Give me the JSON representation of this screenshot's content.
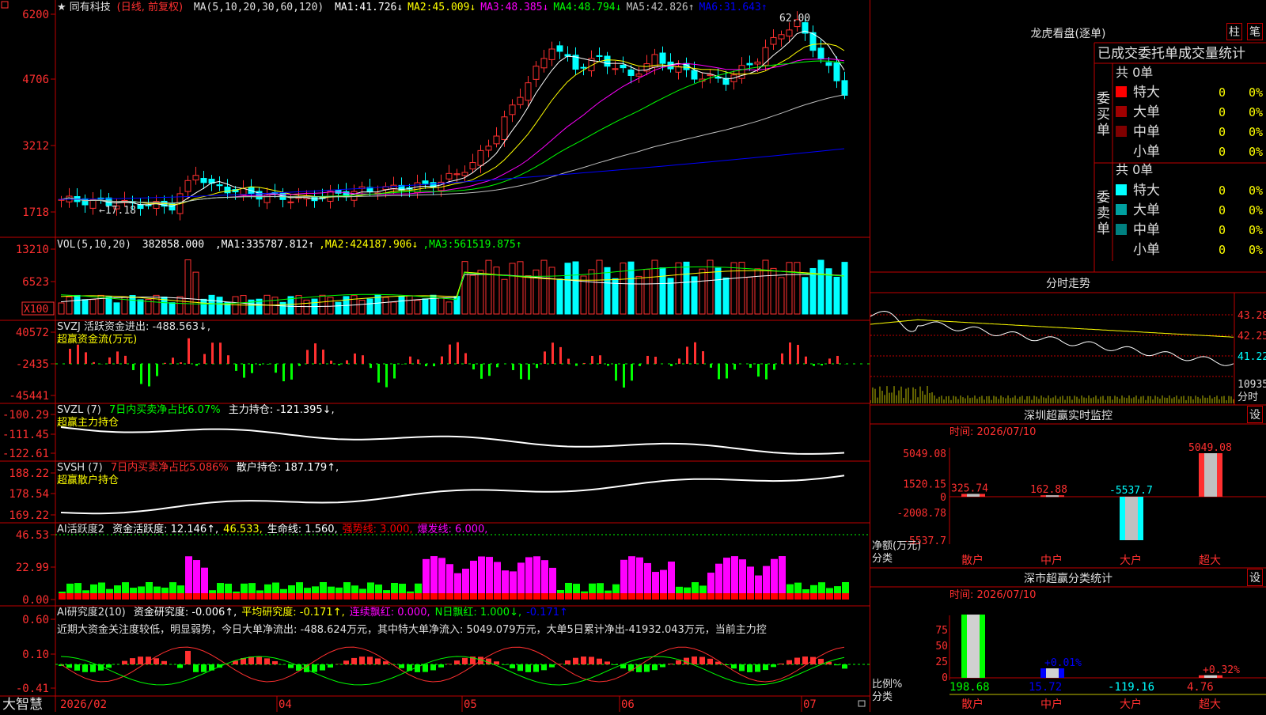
{
  "logo_text": "大智慧",
  "main_chart": {
    "title": "★ 同有科技",
    "period_label": "(日线, 前复权)",
    "ma_header": "MA(5,10,20,30,60,120)",
    "ma_values": [
      {
        "label": "MA1:",
        "value": "41.726",
        "arrow": "↓",
        "color": "#ffffff"
      },
      {
        "label": "MA2:",
        "value": "45.009",
        "arrow": "↓",
        "color": "#ffff00"
      },
      {
        "label": "MA3:",
        "value": "48.385",
        "arrow": "↓",
        "color": "#ff00ff"
      },
      {
        "label": "MA4:",
        "value": "48.794",
        "arrow": "↓",
        "color": "#00ff00"
      },
      {
        "label": "MA5:",
        "value": "42.826",
        "arrow": "↑",
        "color": "#c0c0c0"
      },
      {
        "label": "MA6:",
        "value": "31.643",
        "arrow": "↑",
        "color": "#0000ff"
      }
    ],
    "y_ticks": [
      "6200",
      "4706",
      "3212",
      "1718"
    ],
    "low_marker": "←17.18",
    "high_marker": "62.00"
  },
  "vol_panel": {
    "header": "VOL(5,10,20)",
    "value": "382858.000",
    "mas": [
      {
        "label": "MA1:",
        "value": "335787.812",
        "arrow": "↑",
        "color": "#ffffff"
      },
      {
        "label": "MA2:",
        "value": "424187.906",
        "arrow": "↓",
        "color": "#ffff00"
      },
      {
        "label": "MA3:",
        "value": "561519.875",
        "arrow": "↑",
        "color": "#00ff00"
      }
    ],
    "y_ticks": [
      "13210",
      "6523"
    ],
    "unit": "X100"
  },
  "svzj_panel": {
    "line1": "SVZJ  活跃资金进出: -488.563↓,",
    "line2": "超赢资金流(万元)",
    "y_ticks": [
      "40572",
      "-2435",
      "-45441"
    ]
  },
  "svzl_panel": {
    "name": "SVZL (7)",
    "part1": "7日内买卖净占比6.07%",
    "part2": "主力持仓: -121.395↓,",
    "line2": "超赢主力持仓",
    "y_ticks": [
      "-100.29",
      "-111.45",
      "-122.61"
    ]
  },
  "svsh_panel": {
    "name": "SVSH (7)",
    "part1": "7日内买卖净占比5.086%",
    "part2": "散户持仓: 187.179↑,",
    "line2": "超赢散户持仓",
    "y_ticks": [
      "188.22",
      "178.54",
      "169.22"
    ]
  },
  "ai2_panel": {
    "name": "AI活跃度2",
    "items": [
      {
        "text": "资金活跃度: 12.146↑,",
        "color": "#ffffff"
      },
      {
        "text": "46.533,",
        "color": "#ffff00"
      },
      {
        "text": "生命线: 1.560,",
        "color": "#ffffff"
      },
      {
        "text": "强势线: 3.000,",
        "color": "#ff0000"
      },
      {
        "text": "爆发线: 6.000,",
        "color": "#ff00ff"
      }
    ],
    "y_ticks": [
      "46.53",
      "22.99",
      "0.00"
    ]
  },
  "ai_research_panel": {
    "name": "AI研究度2(10)",
    "items": [
      {
        "text": "资金研究度: -0.006↑,",
        "color": "#ffffff"
      },
      {
        "text": "平均研究度: -0.171↑,",
        "color": "#ffff00"
      },
      {
        "text": "连续飘红: 0.000,",
        "color": "#ff00ff"
      },
      {
        "text": "N日飘红: 1.000↓,",
        "color": "#00ff00"
      },
      {
        "text": "-0.171↑",
        "color": "#0000ff"
      }
    ],
    "comment": "近期大资金关注度较低，明显弱势，今日大单净流出: -488.624万元，其中特大单净流入: 5049.079万元，大单5日累计净出-41932.043万元，当前主力控",
    "y_ticks": [
      "0.60",
      "0.10",
      "-0.41"
    ]
  },
  "x_axis": [
    "2026/02",
    "04",
    "05",
    "06",
    "07"
  ],
  "lhb": {
    "title": "龙虎看盘(逐单)",
    "btn1": "柱",
    "btn2": "笔",
    "header": "已成交委托单成交量统计",
    "buy": {
      "side_label": "委买单",
      "total": "共 0单",
      "rows": [
        {
          "name": "特大",
          "count": "0",
          "pct": "0%",
          "color": "#ff0000"
        },
        {
          "name": "大单",
          "count": "0",
          "pct": "0%",
          "color": "#a00000"
        },
        {
          "name": "中单",
          "count": "0",
          "pct": "0%",
          "color": "#800000"
        },
        {
          "name": "小单",
          "count": "0",
          "pct": "0%",
          "color": ""
        }
      ]
    },
    "sell": {
      "side_label": "委卖单",
      "total": "共 0单",
      "rows": [
        {
          "name": "特大",
          "count": "0",
          "pct": "0%",
          "color": "#00ffff"
        },
        {
          "name": "大单",
          "count": "0",
          "pct": "0%",
          "color": "#00a0a0"
        },
        {
          "name": "中单",
          "count": "0",
          "pct": "0%",
          "color": "#008080"
        },
        {
          "name": "小单",
          "count": "0",
          "pct": "0%",
          "color": ""
        }
      ]
    }
  },
  "intraday": {
    "title": "分时走势",
    "y_ticks": [
      "43.28",
      "42.25",
      "41.22"
    ],
    "vol_tick": "10935",
    "vol_label": "分时"
  },
  "sz_monitor": {
    "title": "深圳超赢实时监控",
    "btn": "设",
    "time": "时间: 2026/07/10",
    "y_ticks": [
      "5049.08",
      "1520.15",
      "0",
      "-2008.78",
      "-5537.7"
    ],
    "y_label": "净额(万元)",
    "x_label": "分类",
    "categories": [
      "散户",
      "中户",
      "大户",
      "超大"
    ],
    "values": [
      325.74,
      162.88,
      -5537.7,
      5049.08
    ],
    "value_labels": [
      "325.74",
      "162.88",
      "-5537.7",
      "5049.08"
    ]
  },
  "sz_class": {
    "title": "深市超赢分类统计",
    "btn": "设",
    "time": "时间: 2026/07/10",
    "y_ticks": [
      "75",
      "50",
      "25",
      "0"
    ],
    "y_label": "比例%",
    "x_label": "分类",
    "categories": [
      "散户",
      "中户",
      "大户",
      "超大"
    ],
    "bar_pct": [
      100,
      15,
      0,
      4
    ],
    "pct_labels": [
      "",
      "+0.01%",
      "",
      "+0.32%"
    ],
    "values": [
      "198.68",
      "15.72",
      "-119.16",
      "4.76"
    ]
  }
}
